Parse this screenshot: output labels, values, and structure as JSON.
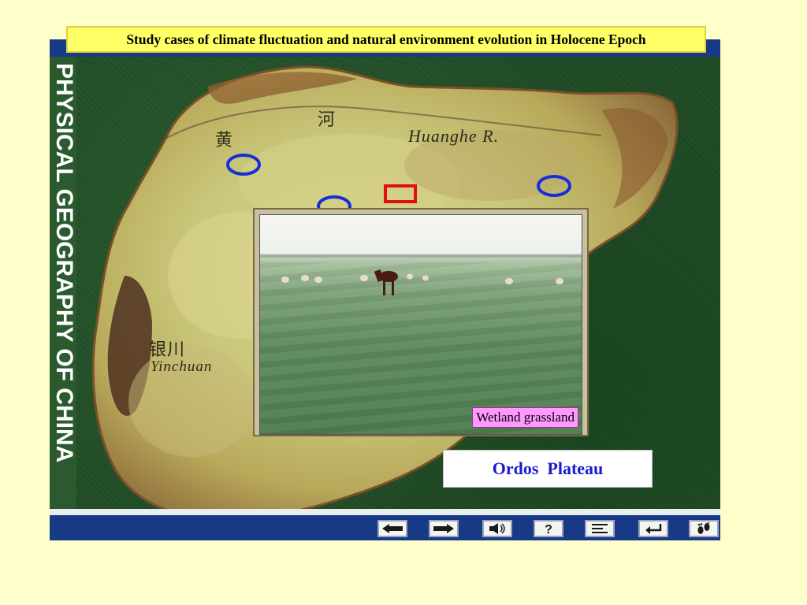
{
  "slide": {
    "title": "Study cases of climate fluctuation and natural environment evolution in Holocene Epoch",
    "side_title": "PHYSICAL GEOGRAPHY OF CHINA"
  },
  "map": {
    "labels": {
      "huanghe_cn_1": "黄",
      "huanghe_cn_2": "河",
      "huanghe_en": "Huanghe R.",
      "yinchuan_cn": "银川",
      "yinchuan_en": "Yinchuan"
    },
    "marker_colors": {
      "study_site": "#1530d8",
      "selected_site": "#e01010"
    }
  },
  "photo": {
    "caption": "Wetland grassland"
  },
  "region_label": "Ordos  Plateau",
  "nav": {
    "buttons": [
      {
        "icon": "arrow-left-icon"
      },
      {
        "icon": "arrow-right-icon"
      },
      {
        "icon": "speaker-icon"
      },
      {
        "icon": "help-icon"
      },
      {
        "icon": "menu-icon"
      },
      {
        "icon": "return-icon"
      },
      {
        "icon": "footprints-icon"
      }
    ]
  }
}
